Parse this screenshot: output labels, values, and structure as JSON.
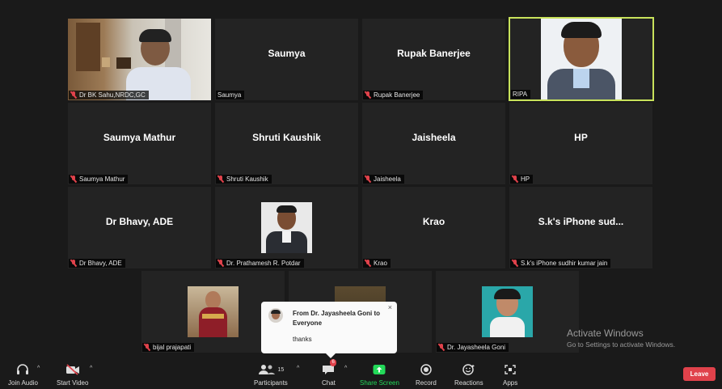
{
  "participants_grid": [
    {
      "big": "",
      "label": "Dr BK Sahu,NRDC,GC"
    },
    {
      "big": "Saumya",
      "label": "Saumya"
    },
    {
      "big": "Rupak Banerjee",
      "label": "Rupak Banerjee"
    },
    {
      "big": "",
      "label": "RIPA"
    },
    {
      "big": "Saumya Mathur",
      "label": "Saumya Mathur"
    },
    {
      "big": "Shruti Kaushik",
      "label": "Shruti Kaushik"
    },
    {
      "big": "Jaisheela",
      "label": "Jaisheela"
    },
    {
      "big": "HP",
      "label": "HP"
    },
    {
      "big": "Dr Bhavy, ADE",
      "label": "Dr Bhavy, ADE"
    },
    {
      "big": "",
      "label": "Dr. Prathamesh R. Potdar"
    },
    {
      "big": "Krao",
      "label": "Krao"
    },
    {
      "big": "S.k's iPhone sud...",
      "label": "S.k's iPhone sudhir kumar jain"
    },
    {
      "big": "",
      "label": "bijal prajapati"
    },
    {
      "big": "",
      "label": ""
    },
    {
      "big": "",
      "label": "Dr. Jayasheela Goni"
    }
  ],
  "chat_popup": {
    "from": "From Dr. Jayasheela Goni to Everyone",
    "message": "thanks",
    "close": "×"
  },
  "watermark": {
    "line1": "Activate Windows",
    "line2": "Go to Settings to activate Windows."
  },
  "toolbar": {
    "join_audio": "Join Audio",
    "start_video": "Start Video",
    "participants": "Participants",
    "participants_count": "15",
    "chat": "Chat",
    "chat_badge": "6",
    "share_screen": "Share Screen",
    "record": "Record",
    "reactions": "Reactions",
    "apps": "Apps",
    "leave": "Leave"
  },
  "colors": {
    "active_speaker": "#c8e25b",
    "share_green": "#23d959",
    "leave_red": "#e0424b"
  }
}
